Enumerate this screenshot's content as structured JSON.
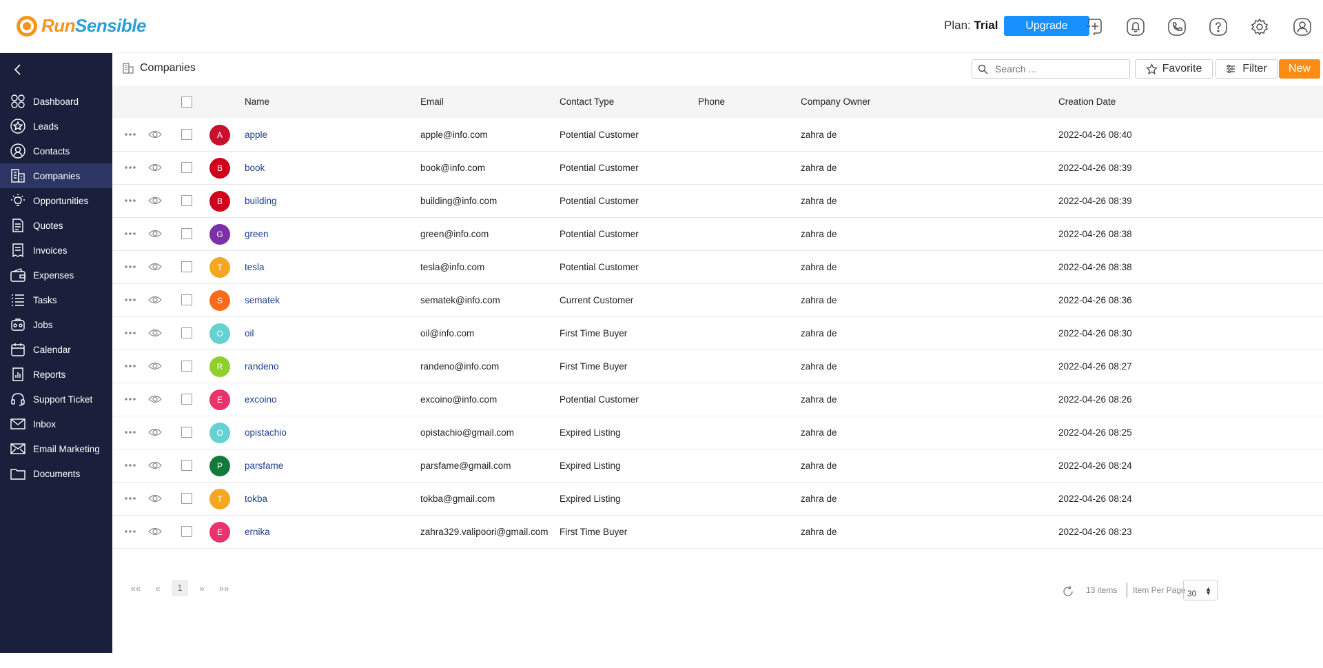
{
  "brand": {
    "run": "Run",
    "sensible": "Sensible"
  },
  "header": {
    "plan_label": "Plan:",
    "plan_value": "Trial",
    "upgrade_label": "Upgrade"
  },
  "sidebar": {
    "items": [
      {
        "label": "Dashboard",
        "icon": "dashboard-icon"
      },
      {
        "label": "Leads",
        "icon": "star-icon"
      },
      {
        "label": "Contacts",
        "icon": "user-icon"
      },
      {
        "label": "Companies",
        "icon": "building-icon",
        "active": true
      },
      {
        "label": "Opportunities",
        "icon": "lightbulb-icon"
      },
      {
        "label": "Quotes",
        "icon": "quote-icon"
      },
      {
        "label": "Invoices",
        "icon": "invoice-icon"
      },
      {
        "label": "Expenses",
        "icon": "wallet-icon"
      },
      {
        "label": "Tasks",
        "icon": "tasks-icon"
      },
      {
        "label": "Jobs",
        "icon": "jobs-icon"
      },
      {
        "label": "Calendar",
        "icon": "calendar-icon"
      },
      {
        "label": "Reports",
        "icon": "reports-icon"
      },
      {
        "label": "Support Ticket",
        "icon": "headset-icon"
      },
      {
        "label": "Inbox",
        "icon": "inbox-icon"
      },
      {
        "label": "Email Marketing",
        "icon": "email-icon"
      },
      {
        "label": "Documents",
        "icon": "folder-icon"
      }
    ]
  },
  "page": {
    "title": "Companies",
    "search_placeholder": "Search ...",
    "favorite_label": "Favorite",
    "filter_label": "Filter",
    "new_label": "New"
  },
  "table": {
    "columns": [
      "Name",
      "Email",
      "Contact Type",
      "Phone",
      "Company Owner",
      "Creation Date"
    ],
    "rows": [
      {
        "initial": "A",
        "color": "#c8102e",
        "name": "apple",
        "email": "apple@info.com",
        "type": "Potential Customer",
        "phone": "",
        "owner": "zahra de",
        "date": "2022-04-26 08:40"
      },
      {
        "initial": "B",
        "color": "#d0021b",
        "name": "book",
        "email": "book@info.com",
        "type": "Potential Customer",
        "phone": "",
        "owner": "zahra de",
        "date": "2022-04-26 08:39"
      },
      {
        "initial": "B",
        "color": "#d0021b",
        "name": "building",
        "email": "building@info.com",
        "type": "Potential Customer",
        "phone": "",
        "owner": "zahra de",
        "date": "2022-04-26 08:39"
      },
      {
        "initial": "G",
        "color": "#7b2fa8",
        "name": "green",
        "email": "green@info.com",
        "type": "Potential Customer",
        "phone": "",
        "owner": "zahra de",
        "date": "2022-04-26 08:38"
      },
      {
        "initial": "T",
        "color": "#f5a623",
        "name": "tesla",
        "email": "tesla@info.com",
        "type": "Potential Customer",
        "phone": "",
        "owner": "zahra de",
        "date": "2022-04-26 08:38"
      },
      {
        "initial": "S",
        "color": "#f76b1c",
        "name": "sematek",
        "email": "sematek@info.com",
        "type": "Current Customer",
        "phone": "",
        "owner": "zahra de",
        "date": "2022-04-26 08:36"
      },
      {
        "initial": "O",
        "color": "#66d1d1",
        "name": "oil",
        "email": "oil@info.com",
        "type": "First Time Buyer",
        "phone": "",
        "owner": "zahra de",
        "date": "2022-04-26 08:30"
      },
      {
        "initial": "R",
        "color": "#8ed12c",
        "name": "randeno",
        "email": "randeno@info.com",
        "type": "First Time Buyer",
        "phone": "",
        "owner": "zahra de",
        "date": "2022-04-26 08:27"
      },
      {
        "initial": "E",
        "color": "#e8336b",
        "name": "excoino",
        "email": "excoino@info.com",
        "type": "Potential Customer",
        "phone": "",
        "owner": "zahra de",
        "date": "2022-04-26 08:26"
      },
      {
        "initial": "O",
        "color": "#66d1d1",
        "name": "opistachio",
        "email": "opistachio@gmail.com",
        "type": "Expired Listing",
        "phone": "",
        "owner": "zahra de",
        "date": "2022-04-26 08:25"
      },
      {
        "initial": "P",
        "color": "#137a3a",
        "name": "parsfame",
        "email": "parsfame@gmail.com",
        "type": "Expired Listing",
        "phone": "",
        "owner": "zahra de",
        "date": "2022-04-26 08:24"
      },
      {
        "initial": "T",
        "color": "#f5a623",
        "name": "tokba",
        "email": "tokba@gmail.com",
        "type": "Expired Listing",
        "phone": "",
        "owner": "zahra de",
        "date": "2022-04-26 08:24"
      },
      {
        "initial": "E",
        "color": "#e8336b",
        "name": "ernika",
        "email": "zahra329.valipoori@gmail.com",
        "type": "First Time Buyer",
        "phone": "",
        "owner": "zahra de",
        "date": "2022-04-26 08:23"
      }
    ]
  },
  "pagination": {
    "first": "««",
    "prev": "«",
    "current": "1",
    "next": "»",
    "last": "»»",
    "items_count": "13 items",
    "per_page_label": "Item Per Page",
    "per_page_value": "30"
  }
}
